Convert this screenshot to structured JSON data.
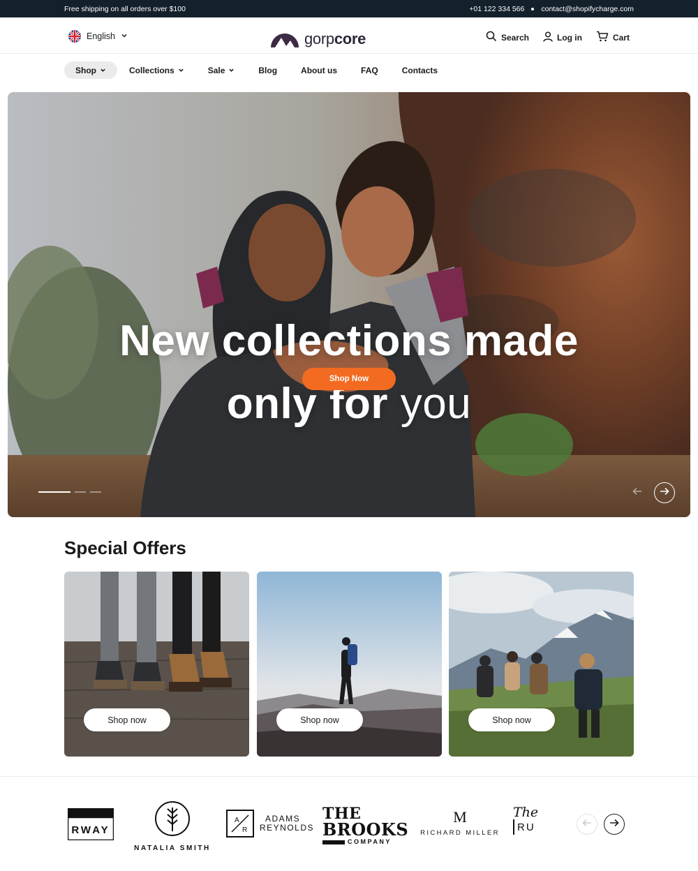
{
  "topbar": {
    "shipping": "Free shipping on all orders over $100",
    "phone": "+01 122 334 566",
    "email": "contact@shopifycharge.com"
  },
  "header": {
    "language": "English",
    "logo_light": "gorp",
    "logo_bold": "core",
    "search_label": "Search",
    "login_label": "Log in",
    "cart_label": "Cart"
  },
  "nav": {
    "items": [
      {
        "label": "Shop",
        "dropdown": true,
        "active": true
      },
      {
        "label": "Collections",
        "dropdown": true
      },
      {
        "label": "Sale",
        "dropdown": true
      },
      {
        "label": "Blog"
      },
      {
        "label": "About us"
      },
      {
        "label": "FAQ"
      },
      {
        "label": "Contacts"
      }
    ]
  },
  "hero": {
    "line1": "New collections made",
    "line2_bold": "only for",
    "line2_thin": "you",
    "cta": "Shop Now",
    "slide_count": 3,
    "current_slide": 1
  },
  "offers": {
    "title_bold": "Special",
    "title_regular": "Offers",
    "cards": [
      {
        "button": "Shop now",
        "scene": "boots-on-dock"
      },
      {
        "button": "Shop now",
        "scene": "hiker-silhouette"
      },
      {
        "button": "Shop now",
        "scene": "group-hiking-mountains"
      }
    ]
  },
  "brands": {
    "items": [
      {
        "name": "RWAY"
      },
      {
        "name": "NATALIA SMITH"
      },
      {
        "name_line1": "ADAMS",
        "name_line2": "REYNOLDS",
        "monogram_a": "A",
        "monogram_b": "R"
      },
      {
        "name_line1": "THE",
        "name_line2": "BROOKS",
        "name_line3": "COMPANY"
      },
      {
        "monogram": "M",
        "name": "RICHARD MILLER"
      },
      {
        "name_line1": "The",
        "name_line2": "RU"
      }
    ]
  },
  "colors": {
    "topbar_bg": "#14202c",
    "accent": "#f26b21",
    "logo": "#3d2a44"
  }
}
